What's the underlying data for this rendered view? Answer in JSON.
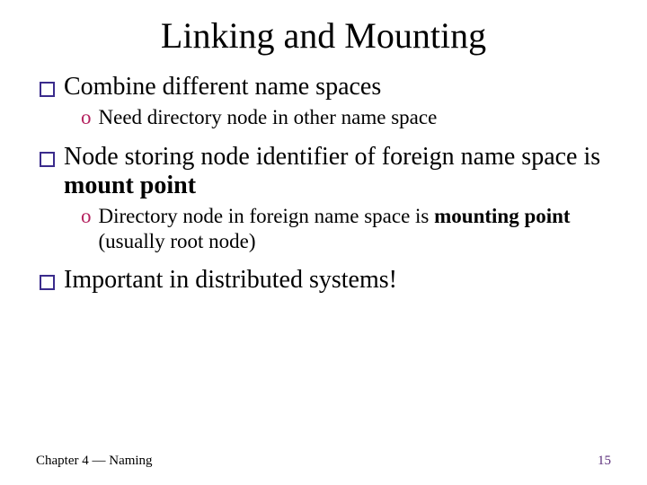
{
  "title": "Linking and Mounting",
  "b1": {
    "text": "Combine different name spaces"
  },
  "b1s1": {
    "text": "Need directory node in other name space"
  },
  "b2": {
    "pre": "Node storing node identifier of foreign name space is ",
    "bold": "mount point"
  },
  "b2s1": {
    "pre": "Directory node in foreign name space is ",
    "bold": "mounting point",
    "post": " (usually root node)"
  },
  "b3": {
    "text": "Important in distributed systems!"
  },
  "footer": {
    "left": "Chapter 4 — Naming",
    "page": "15"
  }
}
